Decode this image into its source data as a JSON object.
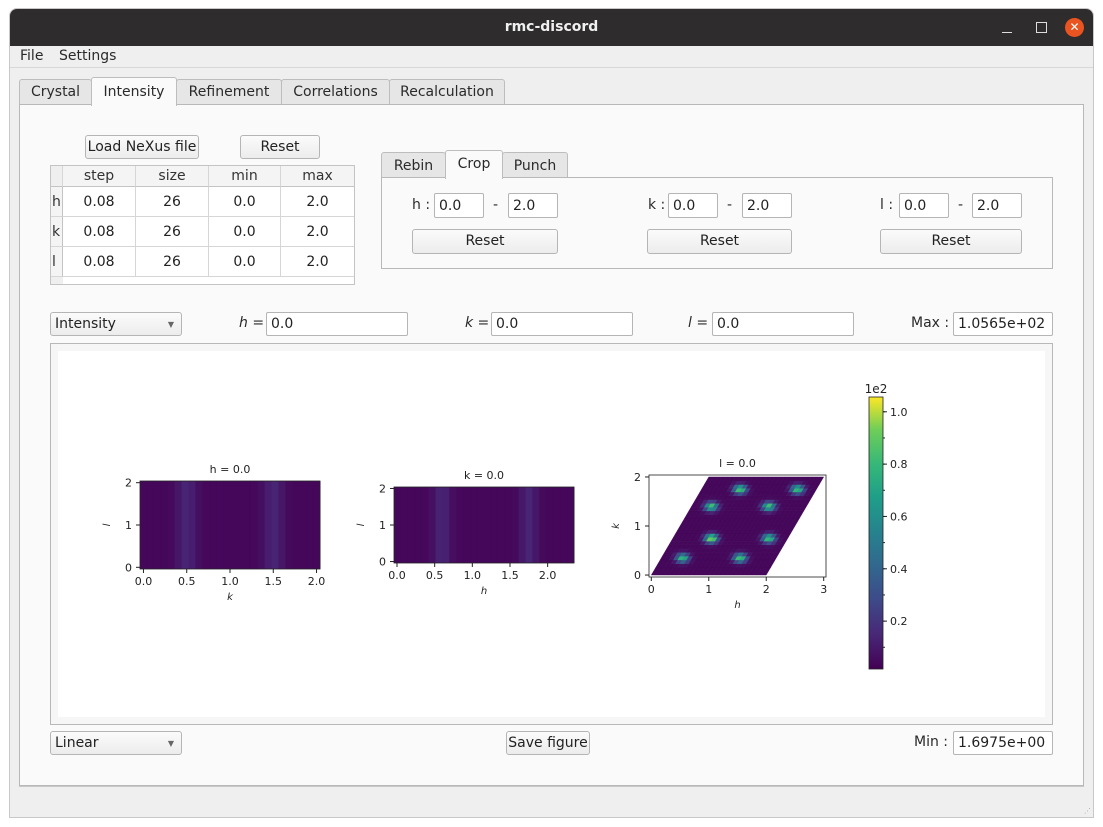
{
  "window": {
    "title": "rmc-discord",
    "close_glyph": "✕"
  },
  "menubar": {
    "items": [
      "File",
      "Settings"
    ]
  },
  "tabs": [
    {
      "label": "Crystal",
      "active": false
    },
    {
      "label": "Intensity",
      "active": true
    },
    {
      "label": "Refinement",
      "active": false
    },
    {
      "label": "Correlations",
      "active": false
    },
    {
      "label": "Recalculation",
      "active": false
    }
  ],
  "intensity": {
    "load_button": "Load NeXus file",
    "reset_button": "Reset",
    "table": {
      "columns": [
        "step",
        "size",
        "min",
        "max"
      ],
      "rows": [
        {
          "label": "h",
          "cells": [
            "0.08",
            "26",
            "0.0",
            "2.0"
          ]
        },
        {
          "label": "k",
          "cells": [
            "0.08",
            "26",
            "0.0",
            "2.0"
          ]
        },
        {
          "label": "l",
          "cells": [
            "0.08",
            "26",
            "0.0",
            "2.0"
          ]
        }
      ]
    },
    "subtabs": [
      {
        "label": "Rebin",
        "active": false
      },
      {
        "label": "Crop",
        "active": true
      },
      {
        "label": "Punch",
        "active": false
      }
    ],
    "crop": {
      "h": {
        "label": "h :",
        "min": "0.0",
        "dash": "-",
        "max": "2.0",
        "reset": "Reset"
      },
      "k": {
        "label": "k :",
        "min": "0.0",
        "dash": "-",
        "max": "2.0",
        "reset": "Reset"
      },
      "l": {
        "label": "l :",
        "min": "0.0",
        "dash": "-",
        "max": "2.0",
        "reset": "Reset"
      }
    },
    "controls": {
      "plot_type": "Intensity",
      "h_label": "h =",
      "h_value": "0.0",
      "k_label": "k =",
      "k_value": "0.0",
      "l_label": "l =",
      "l_value": "0.0",
      "max_label": "Max :",
      "max_value": "1.0565e+02",
      "scale": "Linear",
      "save_button": "Save figure",
      "min_label": "Min :",
      "min_value": "1.6975e+00"
    }
  },
  "chart_data": [
    {
      "type": "heatmap",
      "title": "h = 0.0",
      "xlabel": "k",
      "ylabel": "l",
      "xlim": [
        -0.04,
        2.04
      ],
      "ylim": [
        -0.04,
        2.04
      ],
      "xticks": [
        "0.0",
        "0.5",
        "1.0",
        "1.5",
        "2.0"
      ],
      "yticks": [
        "0",
        "1",
        "2"
      ],
      "pattern": "vertical bands peaking at k = 0.5 and k = 1.5 (low intensity)",
      "colormap": "viridis"
    },
    {
      "type": "heatmap",
      "title": "k = 0.0",
      "xlabel": "h",
      "ylabel": "l",
      "xlim": [
        -0.04,
        2.35
      ],
      "ylim": [
        -0.04,
        2.04
      ],
      "xticks": [
        "0.0",
        "0.5",
        "1.0",
        "1.5",
        "2.0"
      ],
      "yticks": [
        "0",
        "1",
        "2"
      ],
      "pattern": "vertical bands peaking at h ≈ 0.6 and h ≈ 1.75 (low intensity)",
      "colormap": "viridis"
    },
    {
      "type": "heatmap",
      "title": "l = 0.0",
      "xlabel": "h",
      "ylabel": "k",
      "xlim": [
        -0.04,
        3.04
      ],
      "ylim": [
        -0.04,
        2.04
      ],
      "xticks": [
        "0",
        "1",
        "2",
        "3"
      ],
      "yticks": [
        "0",
        "1",
        "2"
      ],
      "shape": "parallelogram (oblique lattice), corners (0,0),(2,0),(3,2),(1,2)",
      "peaks": [
        {
          "h": 0.55,
          "k": 0.35,
          "value": 0.8
        },
        {
          "h": 1.55,
          "k": 0.35,
          "value": 0.85
        },
        {
          "h": 1.05,
          "k": 0.75,
          "value": 1.0
        },
        {
          "h": 2.05,
          "k": 0.75,
          "value": 0.85
        },
        {
          "h": 1.05,
          "k": 1.4,
          "value": 0.85
        },
        {
          "h": 2.05,
          "k": 1.4,
          "value": 0.85
        },
        {
          "h": 1.55,
          "k": 1.75,
          "value": 0.9
        },
        {
          "h": 2.55,
          "k": 1.75,
          "value": 0.85
        }
      ],
      "colormap": "viridis"
    },
    {
      "type": "colorbar",
      "multiplier_label": "1e2",
      "range": [
        0.017,
        1.0565
      ],
      "ticks": [
        "0.2",
        "0.4",
        "0.6",
        "0.8",
        "1.0"
      ],
      "tick_values": [
        0.2,
        0.4,
        0.6,
        0.8,
        1.0
      ],
      "colormap": "viridis"
    }
  ]
}
